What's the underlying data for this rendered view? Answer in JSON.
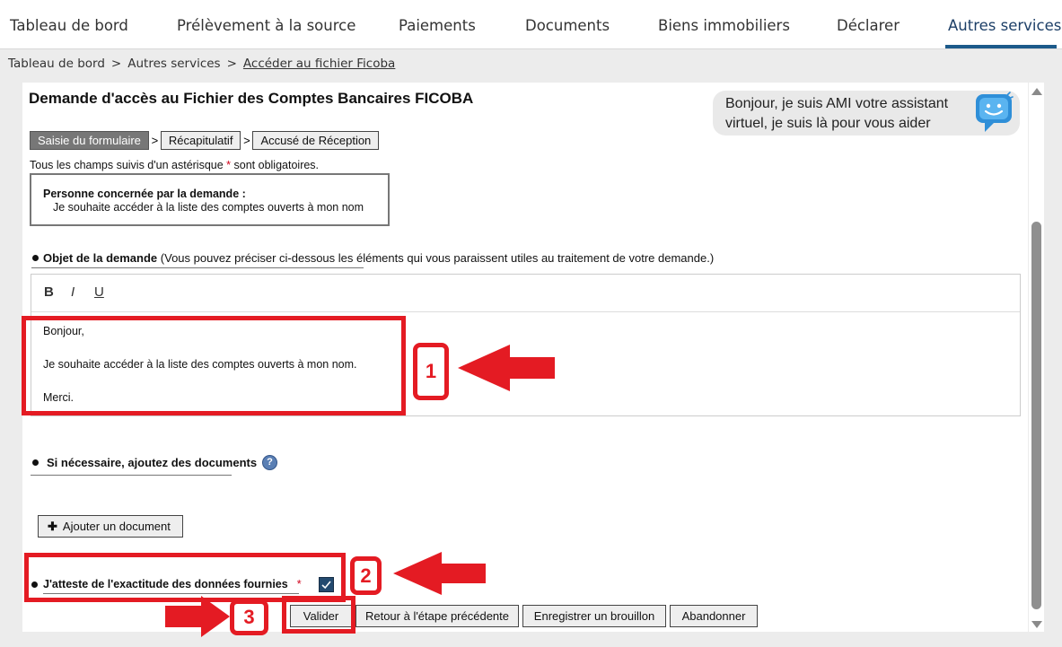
{
  "nav": {
    "tabs": [
      "Tableau de bord",
      "Prélèvement à la source",
      "Paiements",
      "Documents",
      "Biens immobiliers",
      "Déclarer",
      "Autres services"
    ],
    "active_tab": "Autres services"
  },
  "breadcrumb": {
    "items": [
      "Tableau de bord",
      "Autres services"
    ],
    "separator": ">",
    "current": "Accéder au fichier Ficoba"
  },
  "page": {
    "title": "Demande d'accès au Fichier des Comptes Bancaires FICOBA"
  },
  "assistant": {
    "message": "Bonjour, je suis AMI votre assistant virtuel, je suis là pour vous aider",
    "icon": "chat-assistant-icon"
  },
  "steps": {
    "items": [
      "Saisie du formulaire",
      "Récapitulatif",
      "Accusé de Réception"
    ],
    "separator": ">",
    "active_index": 0
  },
  "form": {
    "required_note_prefix": "Tous les champs suivis d'un astérisque",
    "required_star": "*",
    "required_note_suffix": "sont obligatoires.",
    "person": {
      "label": "Personne concernée par la demande :",
      "value": "Je souhaite accéder à la liste des comptes ouverts à mon nom"
    },
    "objet": {
      "label": "Objet de la demande",
      "hint": "(Vous pouvez préciser ci-dessous les éléments qui vous paraissent utiles au traitement de votre demande.)"
    },
    "editor": {
      "toolbar": {
        "bold": "B",
        "italic": "I",
        "underline": "U"
      },
      "lines": [
        "Bonjour,",
        "Je souhaite accéder à la liste des comptes ouverts à mon nom.",
        "Merci."
      ]
    },
    "documents": {
      "label": "Si nécessaire, ajoutez des documents",
      "help": "?",
      "add_button": "Ajouter un document"
    },
    "attest": {
      "label": "J'atteste de l'exactitude des données fournies",
      "star": "*",
      "checked": true
    },
    "buttons": {
      "validate": "Valider",
      "previous": "Retour à l'étape précédente",
      "draft": "Enregistrer un brouillon",
      "abandon": "Abandonner"
    }
  },
  "annotations": {
    "labels": [
      "1",
      "2",
      "3"
    ],
    "color": "#e41b23"
  },
  "colors": {
    "accent": "#1c5a8a",
    "active_step": "#777777",
    "annotation": "#e41b23"
  }
}
